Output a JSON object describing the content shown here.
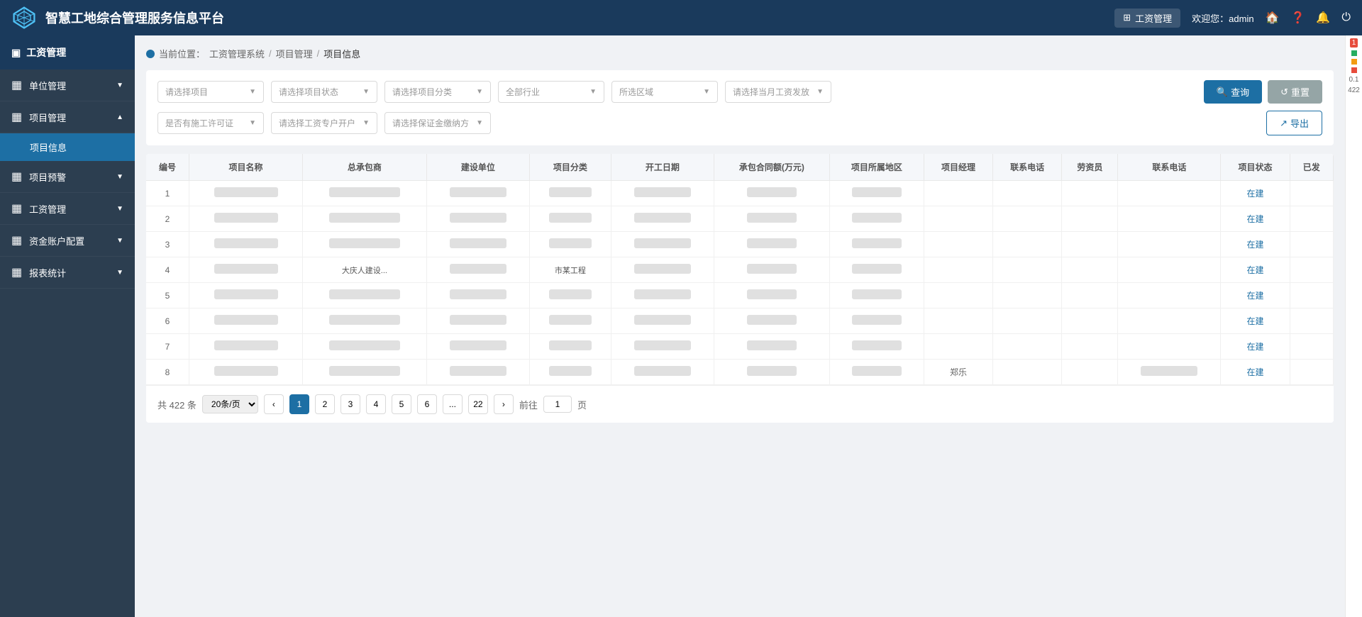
{
  "app": {
    "title": "智慧工地综合管理服务信息平台",
    "module": "工资管理",
    "welcome": "欢迎您：admin"
  },
  "header": {
    "icons": {
      "home": "🏠",
      "help": "❓",
      "bell": "🔔",
      "power": "⏻"
    }
  },
  "sidebar": {
    "header_label": "工资管理",
    "items": [
      {
        "id": "unit",
        "label": "单位管理",
        "icon": "▦",
        "has_children": true,
        "expanded": false
      },
      {
        "id": "project",
        "label": "项目管理",
        "icon": "▦",
        "has_children": true,
        "expanded": true
      },
      {
        "id": "project_info",
        "label": "项目信息",
        "sub": true,
        "active": true
      },
      {
        "id": "project_warning",
        "label": "项目预警",
        "icon": "▦",
        "has_children": true,
        "expanded": false
      },
      {
        "id": "wage",
        "label": "工资管理",
        "icon": "▦",
        "has_children": true,
        "expanded": false
      },
      {
        "id": "fund",
        "label": "资金账户配置",
        "icon": "▦",
        "has_children": true,
        "expanded": false
      },
      {
        "id": "report",
        "label": "报表统计",
        "icon": "▦",
        "has_children": true,
        "expanded": false
      }
    ]
  },
  "breadcrumb": {
    "parts": [
      "工资管理系统",
      "项目管理",
      "项目信息"
    ]
  },
  "filters": {
    "row1": [
      {
        "id": "project",
        "placeholder": "请选择项目"
      },
      {
        "id": "status",
        "placeholder": "请选择项目状态"
      },
      {
        "id": "type",
        "placeholder": "请选择项目分类"
      },
      {
        "id": "industry",
        "placeholder": "全部行业"
      },
      {
        "id": "area",
        "placeholder": "所选区域"
      },
      {
        "id": "salary",
        "placeholder": "请选择当月工资发放"
      }
    ],
    "row2": [
      {
        "id": "license",
        "placeholder": "是否有施工许可证"
      },
      {
        "id": "account",
        "placeholder": "请选择工资专户开户"
      },
      {
        "id": "deposit",
        "placeholder": "请选择保证金缴纳方"
      }
    ],
    "query_btn": "查询",
    "reset_btn": "重置",
    "export_btn": "导出"
  },
  "table": {
    "columns": [
      "编号",
      "项目名称",
      "总承包商",
      "建设单位",
      "项目分类",
      "开工日期",
      "承包合同额(万元)",
      "项目所属地区",
      "项目经理",
      "联系电话",
      "劳资员",
      "联系电话",
      "项目状态",
      "已发"
    ],
    "rows": [
      {
        "no": 1,
        "status": "在建"
      },
      {
        "no": 2,
        "status": "在建"
      },
      {
        "no": 3,
        "status": "在建"
      },
      {
        "no": 4,
        "status": "在建",
        "notes": "大庆人建设..."
      },
      {
        "no": 5,
        "status": "在建"
      },
      {
        "no": 6,
        "status": "在建"
      },
      {
        "no": 7,
        "status": "在建"
      },
      {
        "no": 8,
        "status": "在建",
        "pm": "郑乐"
      }
    ]
  },
  "pagination": {
    "total": "共 422 条",
    "page_size": "20条/页",
    "pages": [
      "1",
      "2",
      "3",
      "4",
      "5",
      "6",
      "...",
      "22"
    ],
    "current": "1",
    "goto_label": "前往",
    "page_unit": "页"
  },
  "right_panel": {
    "badge": "1",
    "count": "422"
  }
}
